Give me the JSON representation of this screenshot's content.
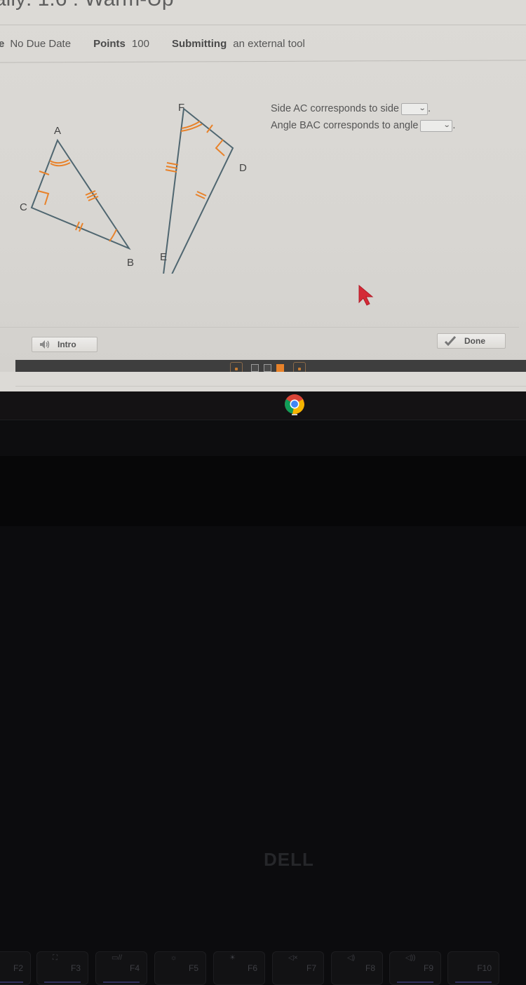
{
  "page": {
    "title_fragment": "ally: 1.6 : Warm-Up",
    "meta": {
      "due_label_fragment": "e",
      "due_value": "No Due Date",
      "points_label": "Points",
      "points_value": "100",
      "submitting_label": "Submitting",
      "submitting_value": "an external tool"
    }
  },
  "activity": {
    "triangle_abc": {
      "vertices": [
        "A",
        "B",
        "C"
      ],
      "right_angle_at": "C"
    },
    "triangle_def": {
      "vertices": [
        "D",
        "E",
        "F"
      ],
      "right_angle_at": "D"
    },
    "questions": [
      {
        "text": "Side AC corresponds to side",
        "selected": "",
        "suffix": "."
      },
      {
        "text": "Angle BAC corresponds to angle",
        "selected": "",
        "suffix": "."
      }
    ],
    "accent_color": "#e8822a",
    "line_color": "#4f6670"
  },
  "footer": {
    "intro_label": "Intro",
    "done_label": "Done",
    "pages_total": 3,
    "current_page": 3
  },
  "desktop": {
    "taskbar_app": "chrome-icon",
    "brand": "DELL",
    "fkeys": [
      {
        "label": "F2",
        "symbol": ""
      },
      {
        "label": "F3",
        "symbol": "⛶"
      },
      {
        "label": "F4",
        "symbol": "▭//"
      },
      {
        "label": "F5",
        "symbol": "☼"
      },
      {
        "label": "F6",
        "symbol": "☀"
      },
      {
        "label": "F7",
        "symbol": "◁×"
      },
      {
        "label": "F8",
        "symbol": "◁)"
      },
      {
        "label": "F9",
        "symbol": "◁))"
      },
      {
        "label": "F10",
        "symbol": ""
      }
    ]
  }
}
